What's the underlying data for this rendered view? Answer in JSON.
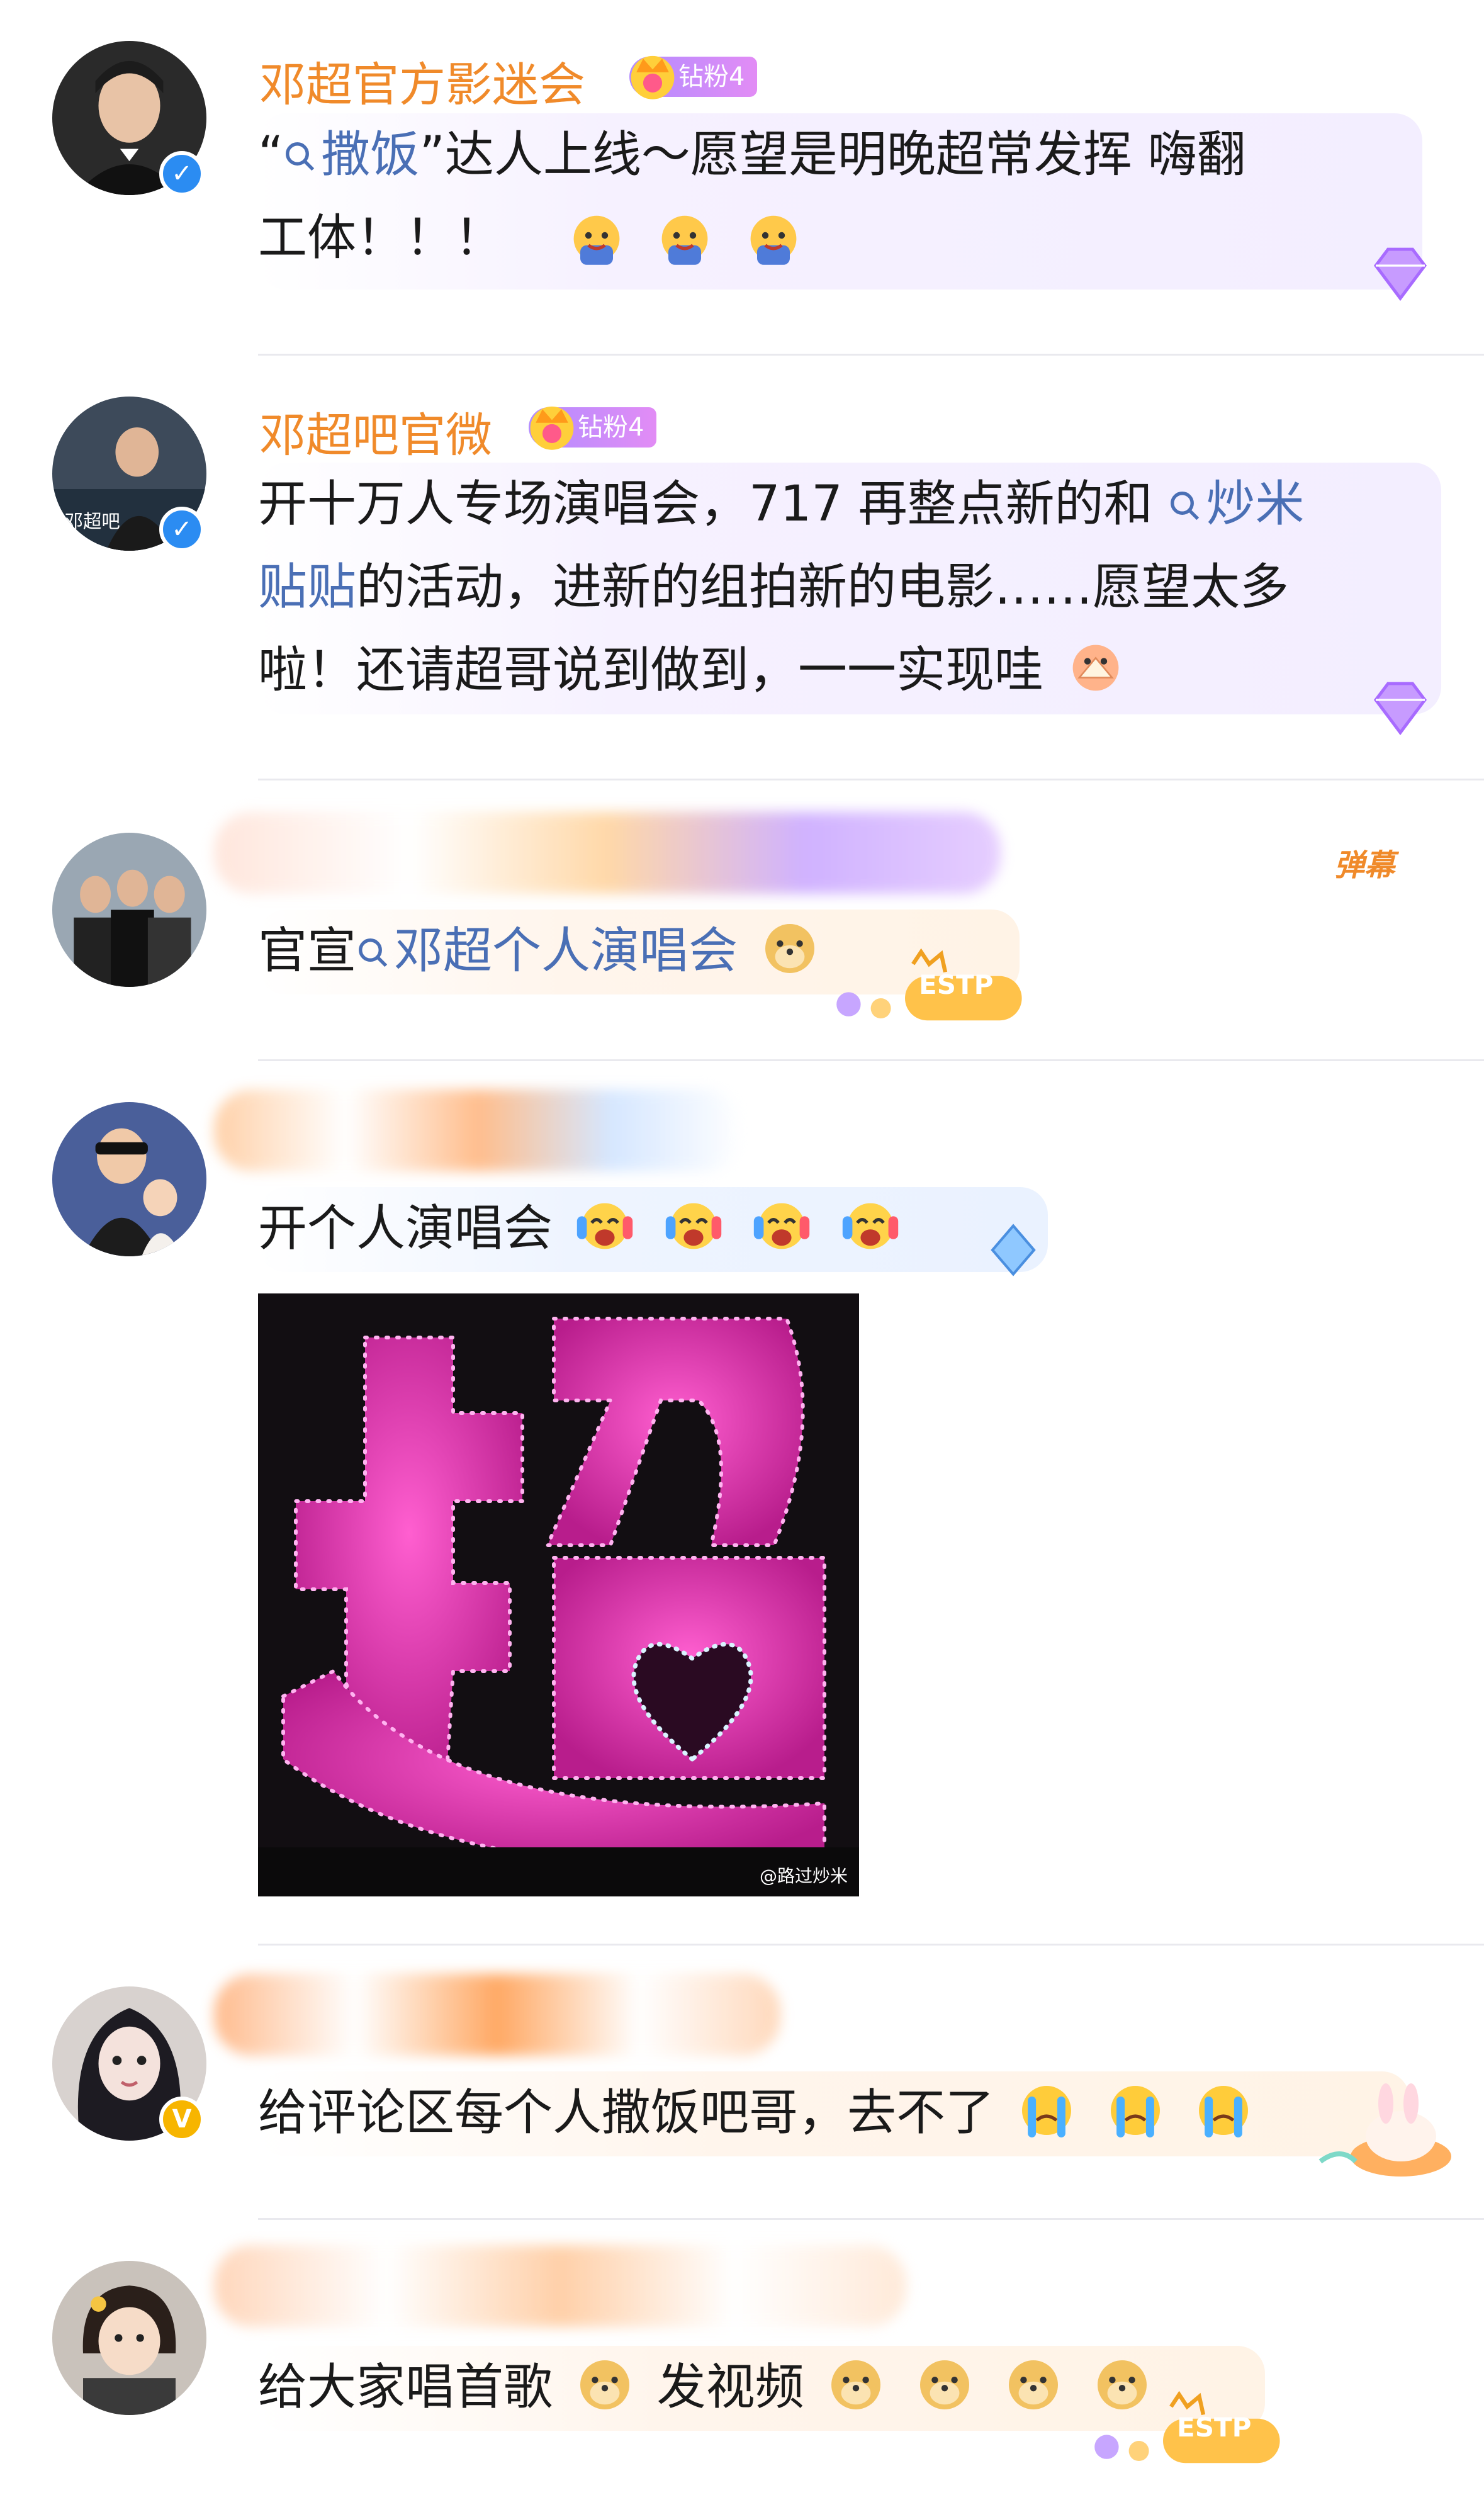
{
  "comments": [
    {
      "username": "邓超官方影迷会",
      "fan_badge": "钻粉4",
      "verified": "blue",
      "text_parts": [
        "“",
        "撒饭",
        "”达人上线～愿望是明晚超常发挥 嗨翻",
        "工体！！！"
      ],
      "link": "撒饭",
      "emojis": [
        "doge-cheer",
        "doge-cheer",
        "doge-cheer"
      ]
    },
    {
      "username": "邓超吧官微",
      "fan_badge": "钻粉4",
      "verified": "blue",
      "line1": "开十万人专场演唱会，717 再整点新的和",
      "link1": "炒米",
      "link2": "贴贴",
      "line2": "的活动，进新的组拍新的电影……愿望太多",
      "line3": "啦！还请超哥说到做到，一一实现哇",
      "emojis": [
        "fan-face"
      ]
    },
    {
      "danmu": "弹幕",
      "prefix": "官宣",
      "link": "邓超个人演唱会",
      "emojis": [
        "doge"
      ],
      "tag": "ESTP"
    },
    {
      "text": "开个人演唱会",
      "emojis": [
        "cheer",
        "cheer",
        "cheer",
        "cheer"
      ],
      "watermark": "@路过炒米"
    },
    {
      "text": "给评论区每个人撒饭吧哥，去不了",
      "emojis": [
        "cry",
        "cry",
        "cry"
      ],
      "verified": "gold"
    },
    {
      "text1": "给大家唱首歌",
      "text2": "发视频",
      "emojis": [
        "doge",
        "doge",
        "doge",
        "doge",
        "doge"
      ],
      "tag": "ESTP"
    }
  ],
  "colors": {
    "username": "#f08a2a",
    "link": "#4a6fb5",
    "badge": "#b28cff",
    "neon": "#ff3fbf"
  },
  "icons": [
    "search-icon",
    "crown-icon",
    "verified-icon",
    "gem-icon"
  ]
}
